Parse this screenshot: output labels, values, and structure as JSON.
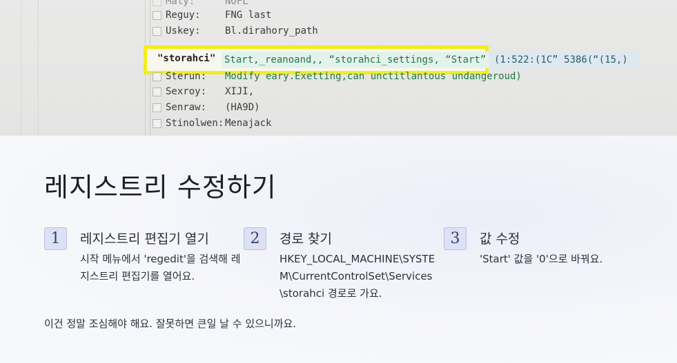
{
  "registry": {
    "rows_top": [
      {
        "key": "Maly:",
        "value": "NOFL"
      },
      {
        "key": "Reguy:",
        "value": "FNG last"
      },
      {
        "key": "Uskey:",
        "value": "Bl.dirahory_path"
      }
    ],
    "highlight": {
      "name": "\"storahci\"",
      "value": "Start,_reanoand,, “storahci_settings, “Start”",
      "extra": "(1:522:(1C” 5386(“(15,)"
    },
    "rows_bottom": [
      {
        "key": "Sterun:",
        "value": "Modify eary.Exetting,can unctitlantous undangeroud)"
      },
      {
        "key": "Sexroy:",
        "value": "XIJI,"
      },
      {
        "key": "Senraw:",
        "value": "(HA9D)"
      },
      {
        "key": "Stinolwen:",
        "value": "Menajack"
      }
    ]
  },
  "card": {
    "title": "레지스트리 수정하기",
    "steps": [
      {
        "number": "1",
        "heading": "레지스트리 편집기 열기",
        "body": "시작 메뉴에서 'regedit'을 검색해 레지스트리 편집기를 열어요."
      },
      {
        "number": "2",
        "heading": "경로 찾기",
        "body": "HKEY_LOCAL_MACHINE\\SYSTEM\\CurrentControlSet\\Services\\storahci 경로로 가요."
      },
      {
        "number": "3",
        "heading": "값 수정",
        "body": "'Start' 값을 '0'으로 바꿔요."
      }
    ],
    "note": "이건 정말 조심해야 해요. 잘못하면 큰일 날 수 있으니까요."
  },
  "colors": {
    "highlight_border": "#f3ec20",
    "step_badge_bg": "#dde1f5",
    "value_green": "#1d7a45"
  }
}
